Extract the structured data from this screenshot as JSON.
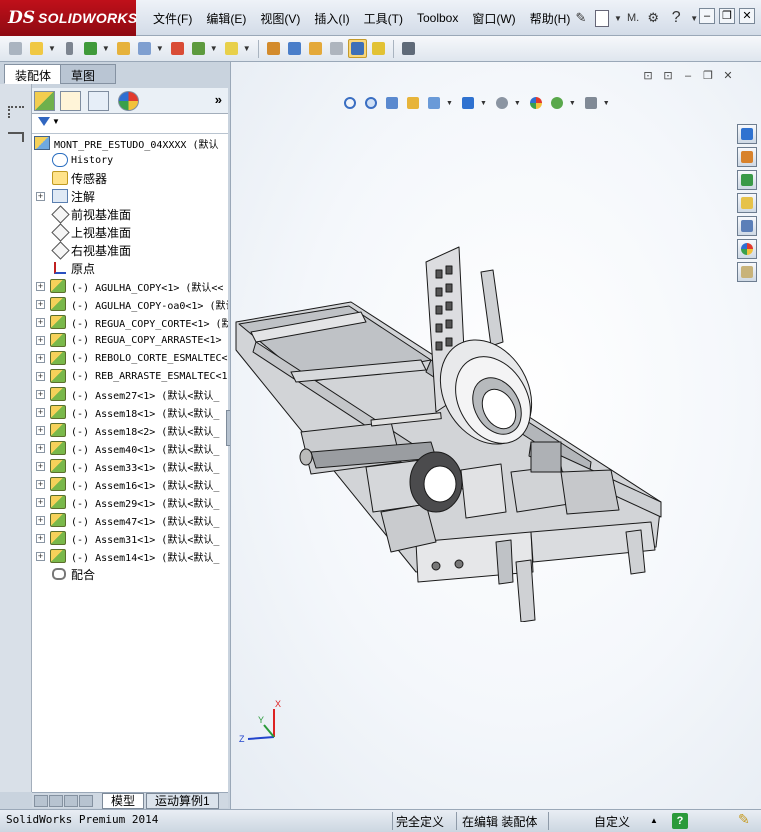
{
  "app": {
    "brand_ds": "DS",
    "brand_name": "SOLIDWORKS"
  },
  "menu": [
    "文件(F)",
    "编辑(E)",
    "视图(V)",
    "插入(I)",
    "工具(T)",
    "Toolbox",
    "窗口(W)",
    "帮助(H)"
  ],
  "title_icons": [
    "pin-icon",
    "new-document-icon",
    "options-icon",
    "help-icon"
  ],
  "title_text": "M.",
  "window_controls": [
    "minimize",
    "restore",
    "close"
  ],
  "panel_tabs": [
    "装配体",
    "草图"
  ],
  "feature_manager": {
    "root": "MONT_PRE_ESTUDO_04XXXX  (默认",
    "fixed_items": [
      {
        "label": "History",
        "icon": "history-icon"
      },
      {
        "label": "传感器",
        "icon": "sensor-icon"
      },
      {
        "label": "注解",
        "icon": "annotation-icon"
      },
      {
        "label": "前视基准面",
        "icon": "plane-icon"
      },
      {
        "label": "上视基准面",
        "icon": "plane-icon"
      },
      {
        "label": "右视基准面",
        "icon": "plane-icon"
      },
      {
        "label": "原点",
        "icon": "origin-icon"
      }
    ],
    "components": [
      "(-) AGULHA_COPY<1>  (默认<<",
      "(-) AGULHA_COPY-oa0<1>  (默认",
      "(-) REGUA_COPY_CORTE<1>  (默",
      "(-) REGUA_COPY_ARRASTE<1>  (",
      "(-) REBOLO_CORTE_ESMALTEC<",
      "(-) REB_ARRASTE_ESMALTEC<1",
      "(-) Assem27<1>  (默认<默认_",
      "(-) Assem18<1>  (默认<默认_",
      "(-) Assem18<2>  (默认<默认_",
      "(-) Assem40<1>  (默认<默认_",
      "(-) Assem33<1>  (默认<默认_",
      "(-) Assem16<1>  (默认<默认_",
      "(-) Assem29<1>  (默认<默认_",
      "(-) Assem47<1>  (默认<默认_",
      "(-) Assem31<1>  (默认<默认_",
      "(-) Assem14<1>  (默认<默认_"
    ],
    "mates": "配合"
  },
  "bottom_tabs": [
    "模型",
    "运动算例1"
  ],
  "status": {
    "product": "SolidWorks Premium 2014",
    "definition": "完全定义",
    "editing": "在编辑 装配体",
    "units": "自定义"
  },
  "triad": {
    "x": "X",
    "y": "Y",
    "z": "Z"
  },
  "colors": {
    "brand_red": "#b00c16",
    "toolbar_bg": "#dfe6ee",
    "tree_bg": "#ffffff",
    "model_steel": "#c7c9cc"
  }
}
